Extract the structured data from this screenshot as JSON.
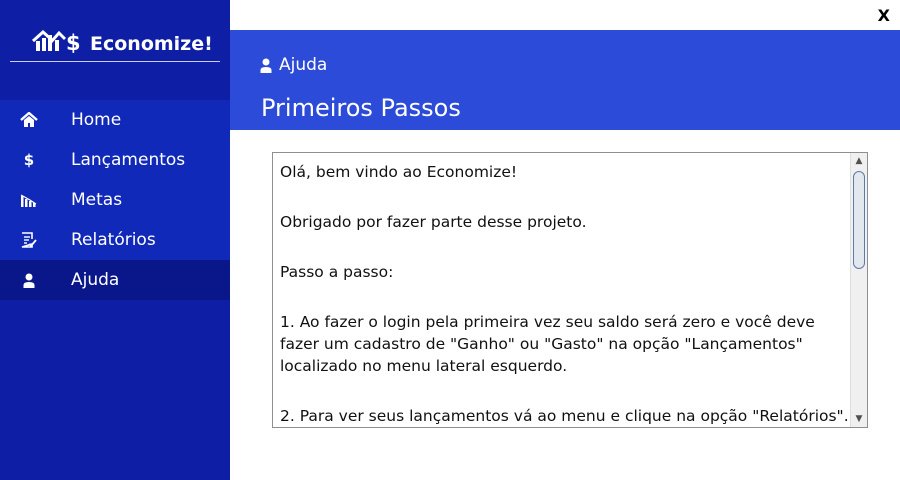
{
  "window": {
    "close_label": "X"
  },
  "sidebar": {
    "brand_name": "Economize!",
    "brand_icon": "house-chart-dollar-icon",
    "items": [
      {
        "label": "Home",
        "icon": "home-icon",
        "active": false
      },
      {
        "label": "Lançamentos",
        "icon": "dollar-icon",
        "active": false
      },
      {
        "label": "Metas",
        "icon": "bar-chart-icon",
        "active": false
      },
      {
        "label": "Relatórios",
        "icon": "report-icon",
        "active": false
      },
      {
        "label": "Ajuda",
        "icon": "user-icon",
        "active": true
      }
    ]
  },
  "header": {
    "breadcrumb": "Ajuda",
    "title": "Primeiros Passos"
  },
  "content": {
    "paragraphs": [
      "Olá, bem vindo ao Economize!",
      "Obrigado por fazer parte desse projeto.",
      "Passo a passo:",
      "1. Ao fazer o login pela primeira vez seu saldo será zero e você deve fazer um cadastro de \"Ganho\" ou \"Gasto\" na opção \"Lançamentos\" localizado no menu lateral esquerdo.",
      "2. Para ver seus lançamentos vá ao menu e clique na opção \"Relatórios\"."
    ]
  },
  "colors": {
    "sidebar_bg": "#1029b8",
    "sidebar_active": "#0a178a",
    "header_bg": "#2b4bd8"
  }
}
